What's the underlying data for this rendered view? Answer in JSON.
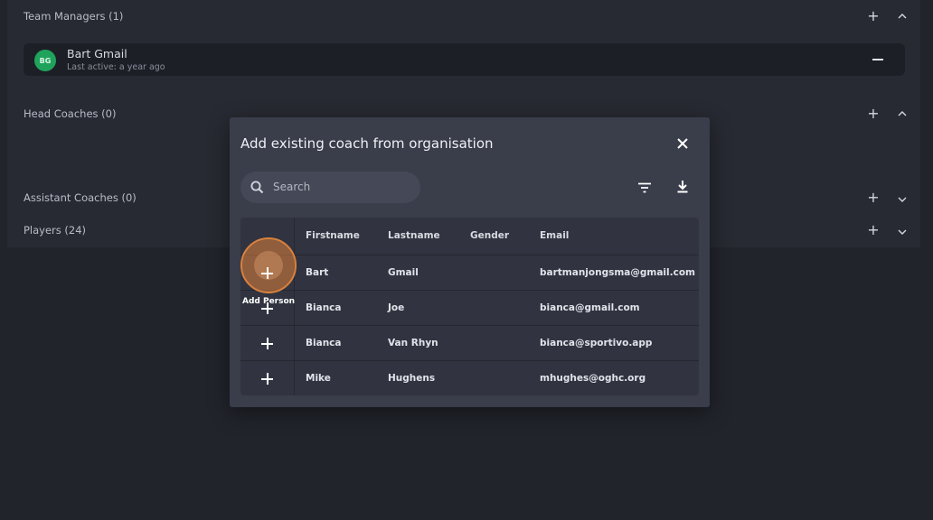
{
  "sections": {
    "team_managers": "Team Managers (1)",
    "head_coaches": "Head Coaches (0)",
    "assistant_coaches": "Assistant Coaches (0)",
    "players": "Players (24)"
  },
  "member": {
    "initials": "BG",
    "name": "Bart Gmail",
    "last_active": "Last active: a year ago"
  },
  "modal": {
    "title": "Add existing coach from organisation",
    "search_placeholder": "Search"
  },
  "table": {
    "headers": [
      "Firstname",
      "Lastname",
      "Gender",
      "Email"
    ],
    "rows": [
      {
        "firstname": "Bart",
        "lastname": "Gmail",
        "gender": "",
        "email": "bartmanjongsma@gmail.com"
      },
      {
        "firstname": "Bianca",
        "lastname": "Joe",
        "gender": "",
        "email": "bianca@gmail.com"
      },
      {
        "firstname": "Bianca",
        "lastname": "Van Rhyn",
        "gender": "",
        "email": "bianca@sportivo.app"
      },
      {
        "firstname": "Mike",
        "lastname": "Hughens",
        "gender": "",
        "email": "mhughes@oghc.org"
      }
    ]
  },
  "tooltip": "Add Person",
  "icons": {
    "section_add": "plus-icon",
    "section_expand": "chevron-up-icon",
    "section_collapse": "chevron-down-icon",
    "close": "close-icon",
    "search": "search-icon",
    "filter": "filter-icon",
    "download": "download-icon",
    "row_add": "plus-icon",
    "remove": "minus-icon"
  },
  "colors": {
    "background": "#22242c",
    "panel": "#282a33",
    "modal": "#3a3d4a",
    "avatar": "#1fa35c",
    "highlight": "#d9813d"
  }
}
